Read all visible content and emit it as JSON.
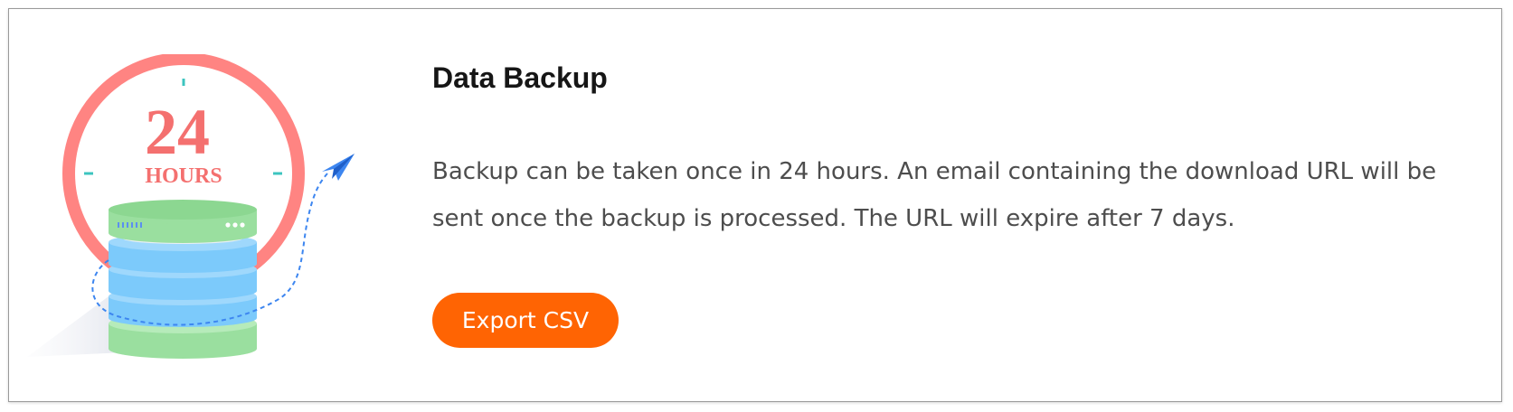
{
  "illustration": {
    "clock_number": "24",
    "clock_unit": "HOURS",
    "icon": "database-backup-clock-illustration",
    "colors": {
      "clock_ring": "#ff8482",
      "clock_text": "#f4706f",
      "tick": "#3cc4bf",
      "db_green": "#9adf9f",
      "db_blue": "#7ccafb",
      "plane": "#3d86f0",
      "dashed_path": "#3d86f0"
    }
  },
  "panel": {
    "title": "Data Backup",
    "description": "Backup can be taken once in 24 hours. An email containing the download URL will be sent once the backup is processed. The URL will expire after 7 days.",
    "export_button_label": "Export CSV"
  },
  "colors": {
    "accent": "#ff6403",
    "title_text": "#161616",
    "body_text": "#4d4d4d",
    "card_border": "#9a9a9a"
  }
}
